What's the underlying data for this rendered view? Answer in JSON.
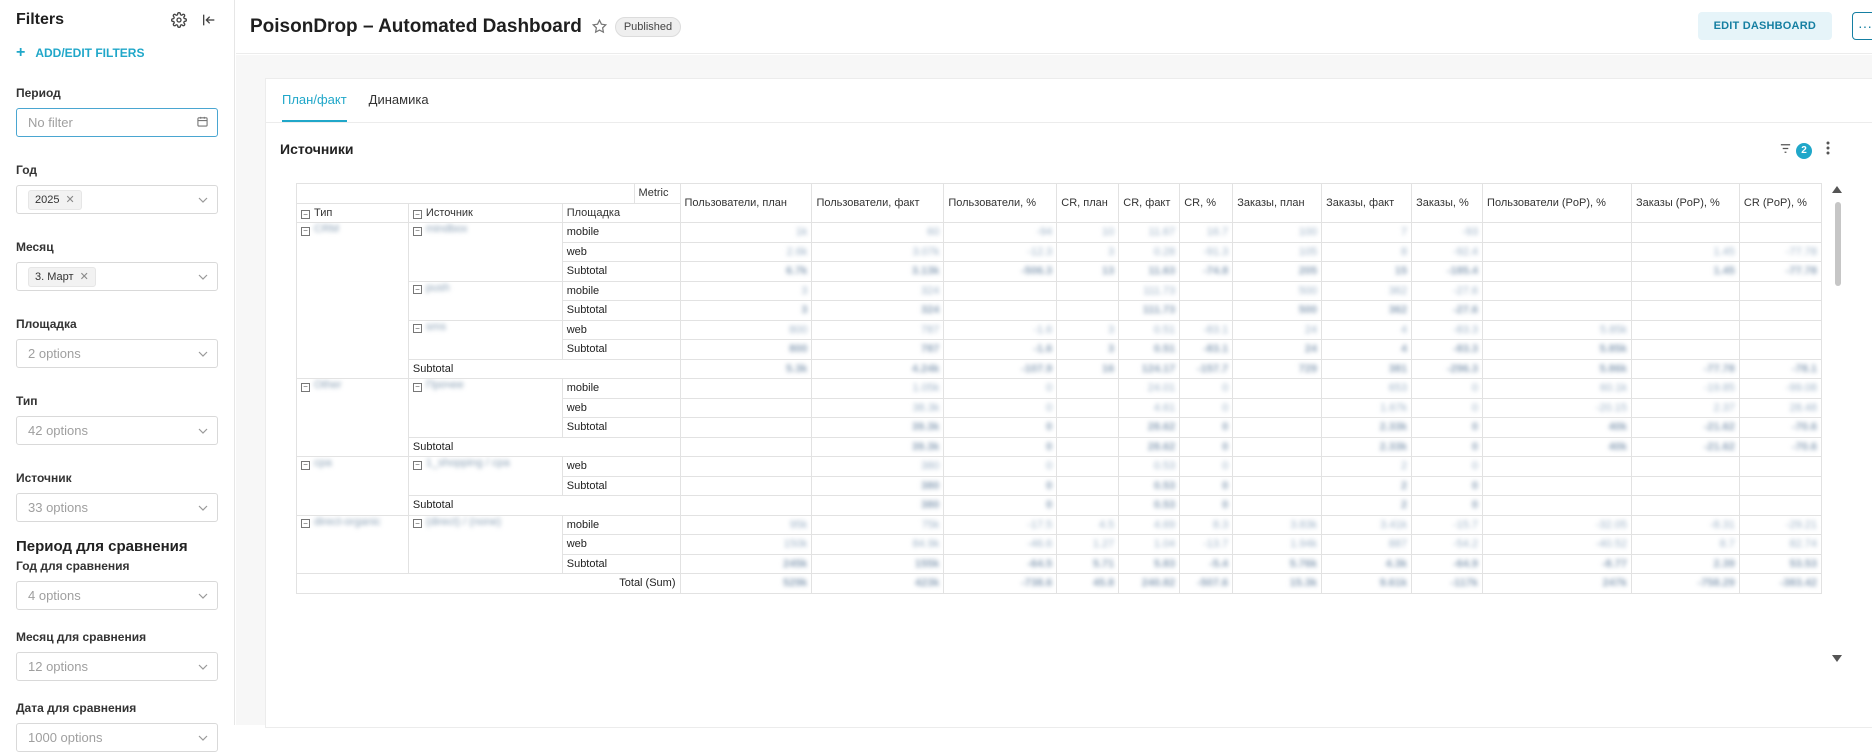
{
  "sidebar": {
    "title": "Filters",
    "add_filters": "ADD/EDIT FILTERS",
    "filters": [
      {
        "label": "Период",
        "value": "No filter"
      },
      {
        "label": "Год",
        "tag": "2025"
      },
      {
        "label": "Месяц",
        "tag": "3. Март"
      },
      {
        "label": "Площадка",
        "value": "2 options"
      },
      {
        "label": "Тип",
        "value": "42 options"
      },
      {
        "label": "Источник",
        "value": "33 options"
      }
    ],
    "section_title": "Период для сравнения",
    "compare_filters": [
      {
        "label": "Год для сравнения",
        "value": "4 options"
      },
      {
        "label": "Месяц для сравнения",
        "value": "12 options"
      },
      {
        "label": "Дата для сравнения",
        "value": "1000 options"
      }
    ]
  },
  "header": {
    "title": "PoisonDrop – Automated Dashboard",
    "status": "Published",
    "edit_label": "EDIT DASHBOARD",
    "more_label": "···"
  },
  "tabs": [
    "План/факт",
    "Динамика"
  ],
  "chart": {
    "title": "Источники",
    "filter_count": "2"
  },
  "pivot": {
    "metric_label": "Metric",
    "row_headers": [
      "Тип",
      "Источник",
      "Площадка"
    ],
    "columns": [
      "Пользователи, план",
      "Пользователи, факт",
      "Пользователи, %",
      "CR, план",
      "CR, факт",
      "CR, %",
      "Заказы, план",
      "Заказы, факт",
      "Заказы, %",
      "Пользователи (PoP), %",
      "Заказы (PoP), %",
      "CR (PoP), %"
    ],
    "subtotal_label": "Subtotal",
    "total_label": "Total (Sum)",
    "rows": [
      {
        "tip": "CRM",
        "src": "mindbox",
        "plat": "mobile",
        "kind": "row",
        "vals": [
          "1k",
          "60",
          "-94",
          "10",
          "11.67",
          "16.7",
          "100",
          "7",
          "-93",
          "",
          "",
          ""
        ]
      },
      {
        "tip": "",
        "src": "",
        "plat": "web",
        "kind": "row",
        "vals": [
          "2.6k",
          "3.07k",
          "-12.3",
          "3",
          "0.28",
          "-91.3",
          "105",
          "8",
          "-92.4",
          "",
          "1.45",
          "-77.78"
        ]
      },
      {
        "tip": "",
        "src": "",
        "plat": "Subtotal",
        "kind": "sub",
        "vals": [
          "6.7k",
          "3.13k",
          "-506.3",
          "13",
          "11.63",
          "-74.8",
          "205",
          "15",
          "-185.4",
          "",
          "1.45",
          "-77.78"
        ]
      },
      {
        "tip": "",
        "src": "push",
        "plat": "mobile",
        "kind": "row",
        "vals": [
          "3",
          "324",
          "",
          "",
          "111.73",
          "",
          "500",
          "362",
          "-27.6",
          "",
          "",
          ""
        ]
      },
      {
        "tip": "",
        "src": "",
        "plat": "Subtotal",
        "kind": "sub",
        "vals": [
          "3",
          "324",
          "",
          "",
          "111.73",
          "",
          "500",
          "362",
          "-27.6",
          "",
          "",
          ""
        ]
      },
      {
        "tip": "",
        "src": "sms",
        "plat": "web",
        "kind": "row",
        "vals": [
          "800",
          "787",
          "-1.6",
          "3",
          "0.51",
          "-83.1",
          "24",
          "4",
          "-83.3",
          "5.85k",
          "",
          ""
        ]
      },
      {
        "tip": "",
        "src": "",
        "plat": "Subtotal",
        "kind": "sub",
        "vals": [
          "800",
          "787",
          "-1.6",
          "3",
          "0.51",
          "-83.1",
          "24",
          "4",
          "-83.3",
          "5.85k",
          "",
          ""
        ]
      },
      {
        "tip": "",
        "src": "Subtotal",
        "plat": "",
        "kind": "sub2",
        "vals": [
          "5.3k",
          "4.24k",
          "-107.9",
          "16",
          "124.17",
          "-157.7",
          "729",
          "381",
          "-296.3",
          "5.86k",
          "-77.78",
          "-78.1"
        ]
      },
      {
        "tip": "Other",
        "src": "Прочее",
        "plat": "mobile",
        "kind": "row",
        "vals": [
          "",
          "1.05k",
          "0",
          "",
          "24.01",
          "0",
          "",
          "653",
          "0",
          "60.1k",
          "-19.85",
          "-99.08"
        ]
      },
      {
        "tip": "",
        "src": "",
        "plat": "web",
        "kind": "row",
        "vals": [
          "",
          "38.3k",
          "0",
          "",
          "4.61",
          "0",
          "",
          "1.67k",
          "0",
          "-20.15",
          "2.37",
          "28.48"
        ]
      },
      {
        "tip": "",
        "src": "",
        "plat": "Subtotal",
        "kind": "sub",
        "vals": [
          "",
          "39.3k",
          "0",
          "",
          "28.62",
          "0",
          "",
          "2.33k",
          "0",
          "40k",
          "-21.62",
          "-70.6"
        ]
      },
      {
        "tip": "",
        "src": "Subtotal",
        "plat": "",
        "kind": "sub2",
        "vals": [
          "",
          "39.3k",
          "0",
          "",
          "28.62",
          "0",
          "",
          "2.33k",
          "0",
          "40k",
          "-21.62",
          "-70.6"
        ]
      },
      {
        "tip": "cpa",
        "src": "1_shopping / cpa",
        "plat": "web",
        "kind": "row",
        "vals": [
          "",
          "380",
          "0",
          "",
          "0.53",
          "0",
          "",
          "2",
          "0",
          "",
          "",
          ""
        ]
      },
      {
        "tip": "",
        "src": "",
        "plat": "Subtotal",
        "kind": "sub",
        "vals": [
          "",
          "380",
          "0",
          "",
          "0.53",
          "0",
          "",
          "2",
          "0",
          "",
          "",
          ""
        ]
      },
      {
        "tip": "",
        "src": "Subtotal",
        "plat": "",
        "kind": "sub2",
        "vals": [
          "",
          "380",
          "0",
          "",
          "0.53",
          "0",
          "",
          "2",
          "0",
          "",
          "",
          ""
        ]
      },
      {
        "tip": "direct-organic",
        "src": "(direct) / (none)",
        "plat": "mobile",
        "kind": "row",
        "vals": [
          "95k",
          "75k",
          "-17.5",
          "4.5",
          "4.69",
          "8.3",
          "3.83k",
          "3.41k",
          "-15.7",
          "-32.05",
          "-8.31",
          "-29.21"
        ]
      },
      {
        "tip": "",
        "src": "",
        "plat": "web",
        "kind": "row",
        "vals": [
          "150k",
          "84.9k",
          "-46.6",
          "1.27",
          "1.04",
          "-13.7",
          "1.94k",
          "887",
          "-54.2",
          "-40.52",
          "8.7",
          "82.74"
        ]
      },
      {
        "tip": "",
        "src": "",
        "plat": "Subtotal",
        "kind": "sub",
        "vals": [
          "245k",
          "155k",
          "-64.5",
          "5.71",
          "5.83",
          "-5.4",
          "5.76k",
          "4.3k",
          "-64.9",
          "-8.77",
          "2.39",
          "53.53"
        ]
      },
      {
        "tip": "",
        "src": "Total (Sum)",
        "plat": "",
        "kind": "total",
        "vals": [
          "529k",
          "423k",
          "-738.6",
          "45.8",
          "240.82",
          "-507.6",
          "15.3k",
          "9.61k",
          "-117k",
          "247k",
          "-758.29",
          "-383.42"
        ]
      }
    ]
  }
}
